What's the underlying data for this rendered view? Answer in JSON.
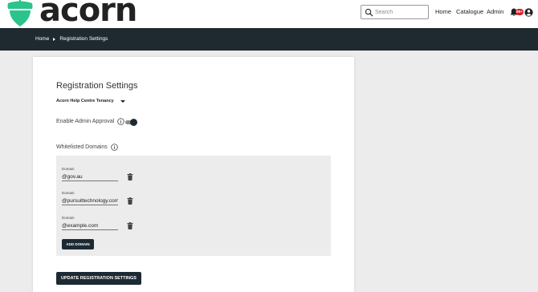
{
  "header": {
    "logo_text": "acorn",
    "search": {
      "placeholder": "Search",
      "value": ""
    },
    "nav": {
      "home": "Home",
      "catalogue": "Catalogue",
      "admin": "Admin"
    },
    "notifications_badge": "99+",
    "icons": [
      "acorn-logo-icon",
      "search-icon",
      "bell-icon",
      "account-circle-icon"
    ]
  },
  "breadcrumb": {
    "home": "Home",
    "current": "Registration Settings"
  },
  "settings": {
    "title": "Registration Settings",
    "tenancy_selected": "Acorn Help Centre Tenancy",
    "admin_approval_label": "Enable Admin Approval",
    "admin_approval_enabled": true,
    "whitelisted_label": "Whitelisted Domains",
    "domains": [
      {
        "label": "Domain",
        "value": "@gov.au"
      },
      {
        "label": "Domain",
        "value": "@pursuittechnology.com.au"
      },
      {
        "label": "Domain",
        "value": "@example.com"
      }
    ],
    "add_domain_label": "ADD DOMAIN",
    "update_label": "UPDATE REGISTRATION SETTINGS"
  },
  "colors": {
    "brand": "#2bc48a",
    "dark": "#1f2a30",
    "button": "#1d2a33",
    "badge": "#d8202a"
  }
}
